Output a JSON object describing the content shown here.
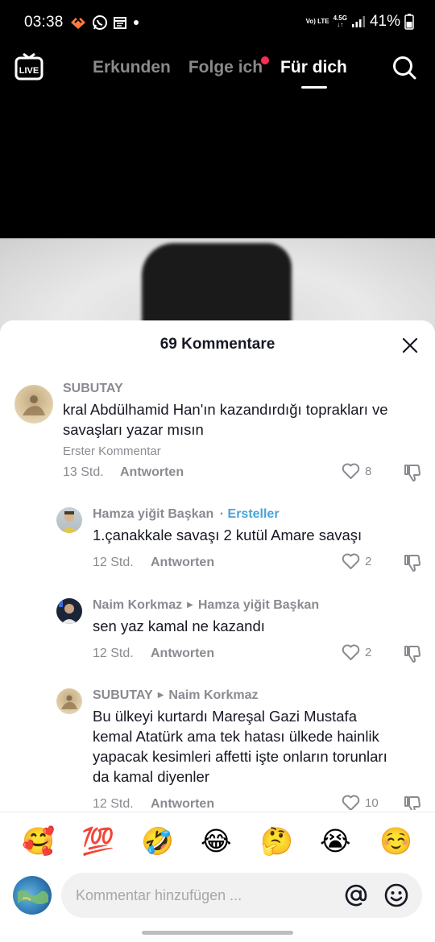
{
  "status_bar": {
    "time": "03:38",
    "battery": "41%",
    "network_label": "Vo) LTE",
    "network_gen": "4.5G"
  },
  "top_nav": {
    "tabs": [
      {
        "label": "Erkunden",
        "active": false
      },
      {
        "label": "Folge ich",
        "active": false,
        "dot": true
      },
      {
        "label": "Für dich",
        "active": true
      }
    ],
    "live_label": "LIVE"
  },
  "sheet": {
    "title": "69 Kommentare"
  },
  "comments": [
    {
      "author": "SUBUTAY",
      "text_lines": [
        "kral Abdülhamid Han'ın kazandırdığı toprakları ve",
        "savaşları yazar mısın"
      ],
      "sublabel": "Erster Kommentar",
      "time": "13 Std.",
      "reply": "Antworten",
      "likes": "8"
    },
    {
      "author": "Hamza yiğit Başkan",
      "badge": "Ersteller",
      "separator": "·",
      "text_lines": [
        "1.çanakkale savaşı 2 kutül Amare savaşı"
      ],
      "time": "12 Std.",
      "reply": "Antworten",
      "likes": "2"
    },
    {
      "author": "Naim Korkmaz",
      "reply_to": "Hamza yiğit Başkan",
      "text_lines": [
        "sen yaz kamal ne kazandı"
      ],
      "time": "12 Std.",
      "reply": "Antworten",
      "likes": "2"
    },
    {
      "author": "SUBUTAY",
      "reply_to": "Naim Korkmaz",
      "text_lines": [
        "Bu ülkeyi kurtardı Mareşal Gazi Mustafa",
        "kemal Atatürk ama tek hatası ülkede hainlik",
        "yapacak kesimleri affetti işte onların torunları",
        "da kamal diyenler"
      ],
      "time": "12 Std.",
      "reply": "Antworten",
      "likes": "10"
    }
  ],
  "emojis": [
    "🥰",
    "💯",
    "🤣",
    "😂",
    "🤔",
    "😭",
    "☺️"
  ],
  "input": {
    "placeholder": "Kommentar hinzufügen ..."
  }
}
